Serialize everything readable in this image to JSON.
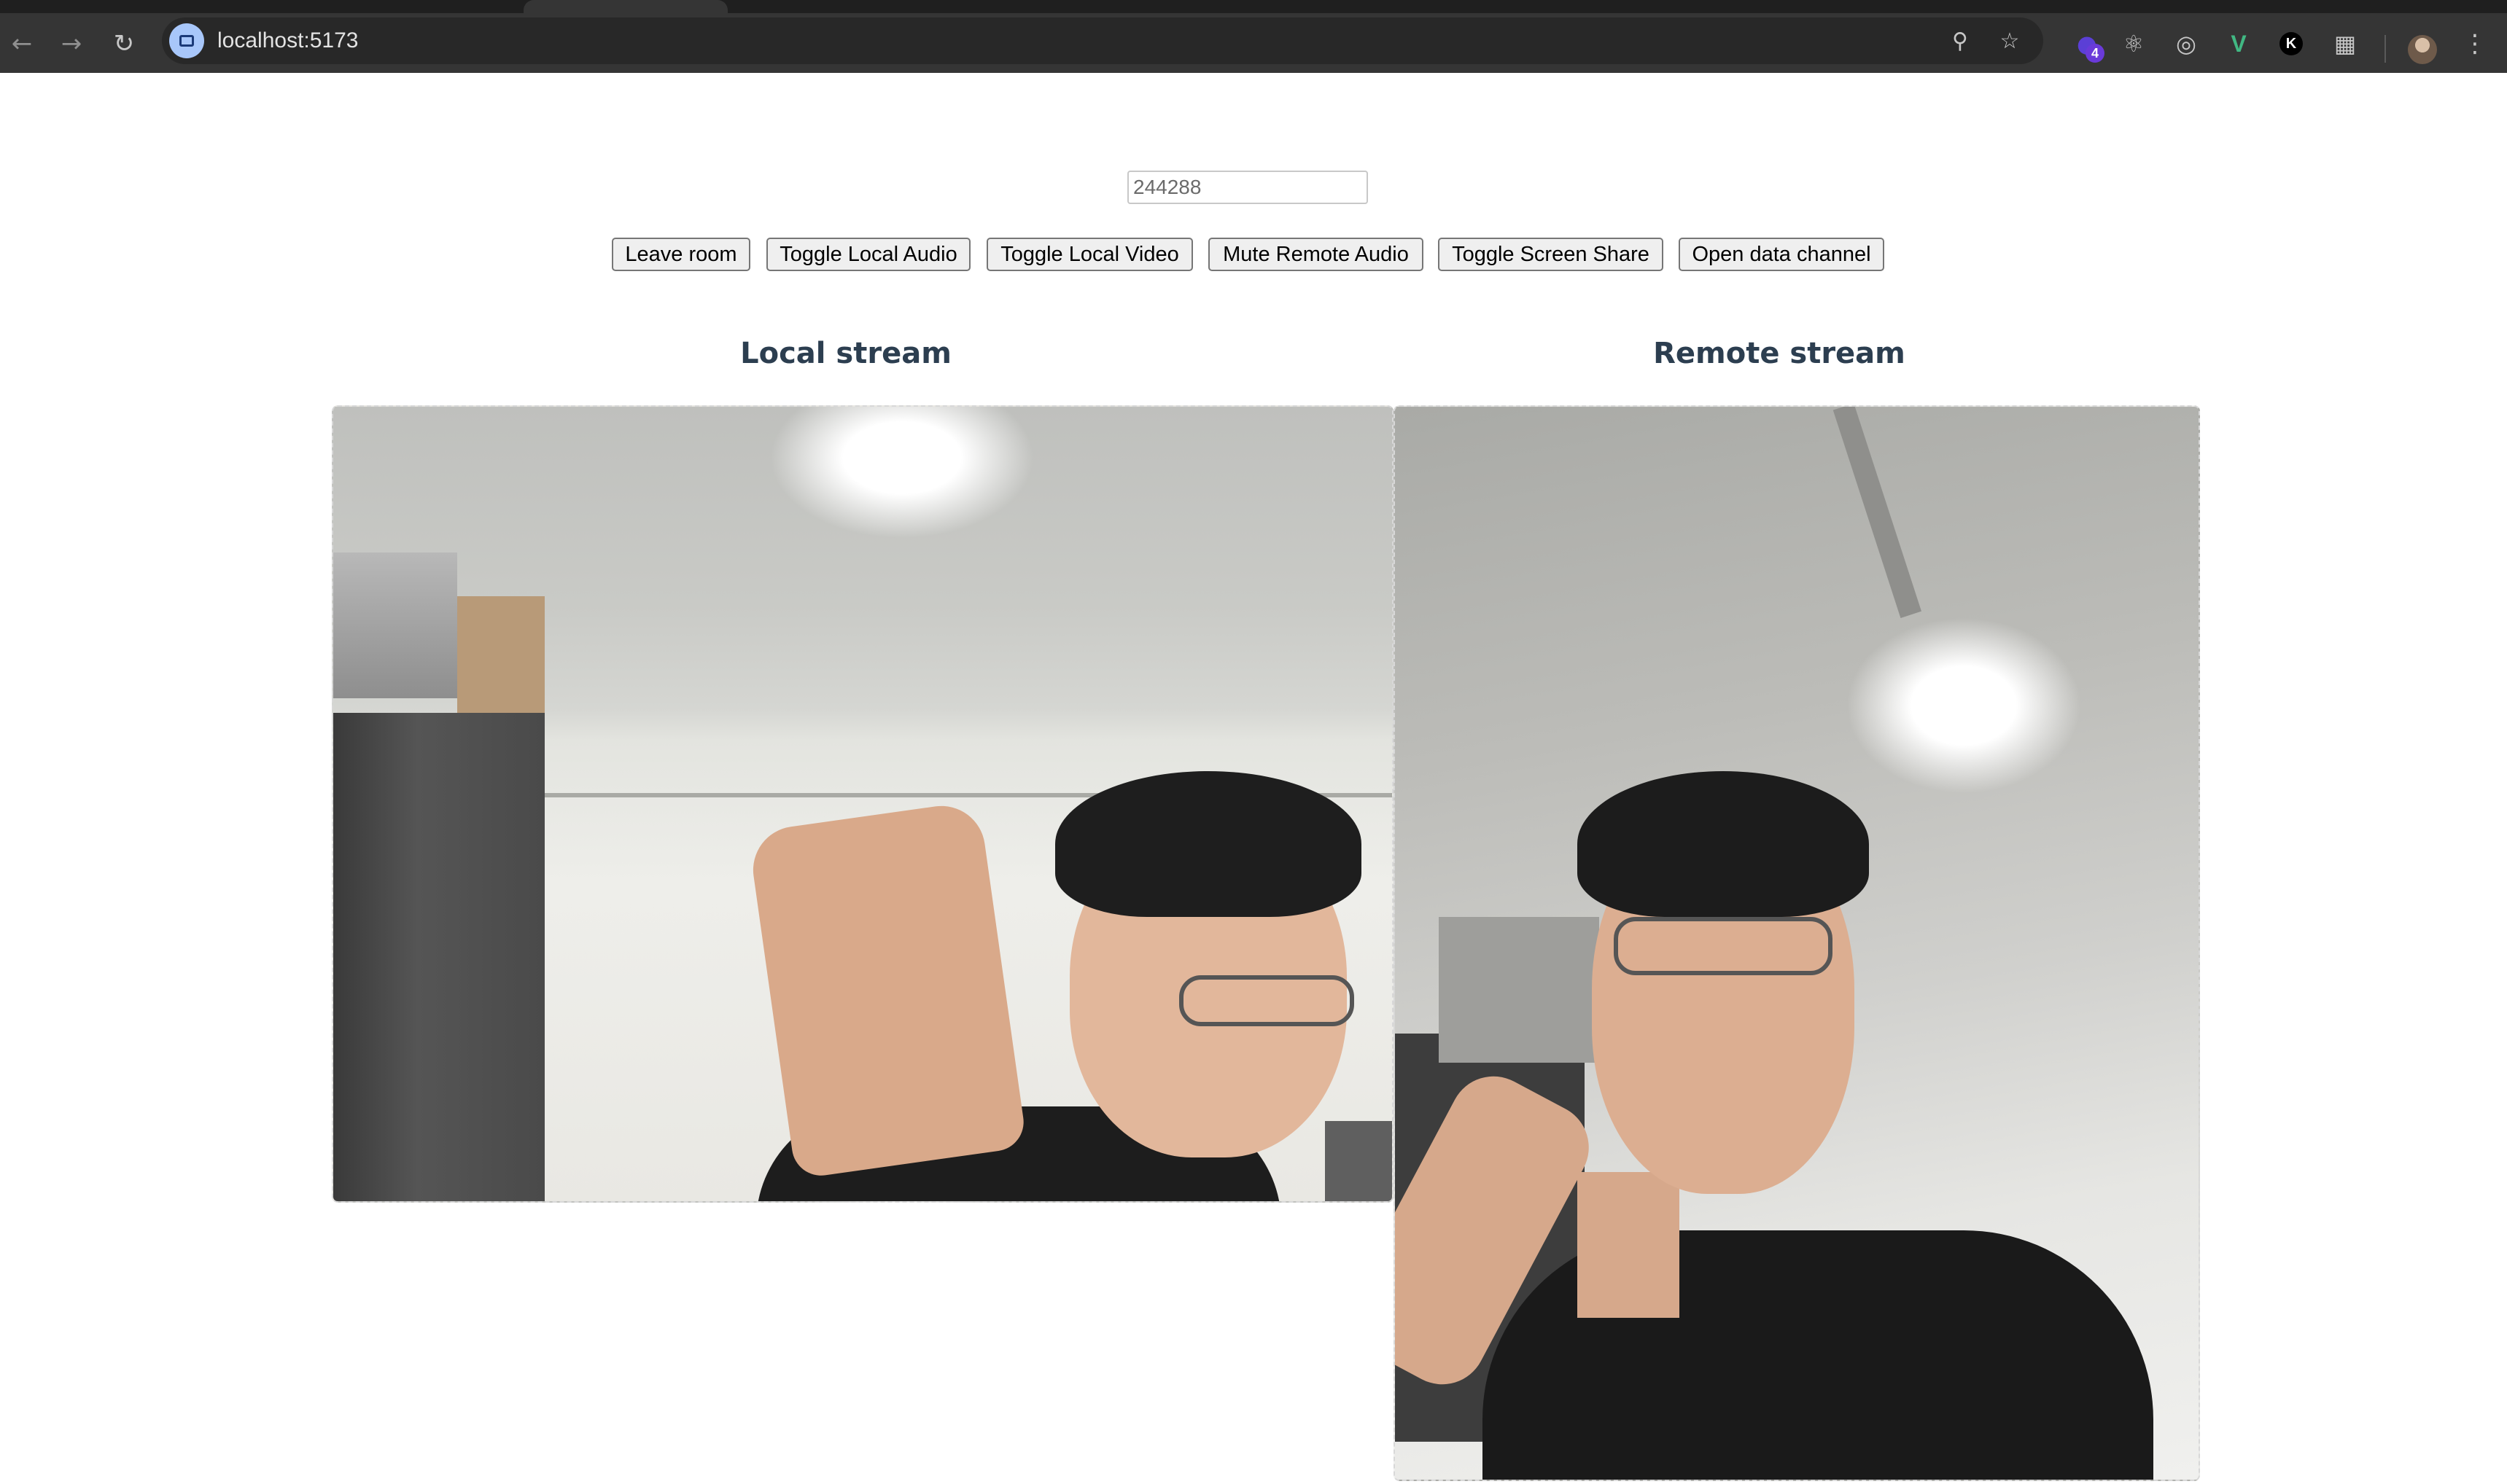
{
  "browser": {
    "url": "localhost:5173",
    "extension_badge": "4",
    "icons": {
      "back": "arrow-left-icon",
      "forward": "arrow-right-icon",
      "reload": "reload-icon",
      "site_info": "video-camera-icon",
      "zoom": "zoom-icon",
      "bookmark": "star-icon",
      "extensions": [
        "extension-purple-icon",
        "react-devtools-icon",
        "target-extension-icon",
        "vue-devtools-icon",
        "k-extension-icon",
        "puzzle-piece-icon"
      ],
      "profile": "avatar",
      "menu": "kebab-menu-icon"
    }
  },
  "page": {
    "room_input": {
      "value": "244288"
    },
    "buttons": {
      "leave_room": "Leave room",
      "toggle_local_audio": "Toggle Local Audio",
      "toggle_local_video": "Toggle Local Video",
      "mute_remote_audio": "Mute Remote Audio",
      "toggle_screen_share": "Toggle Screen Share",
      "open_data_channel": "Open data channel"
    },
    "local_stream": {
      "title": "Local stream"
    },
    "remote_stream": {
      "title": "Remote stream"
    }
  }
}
